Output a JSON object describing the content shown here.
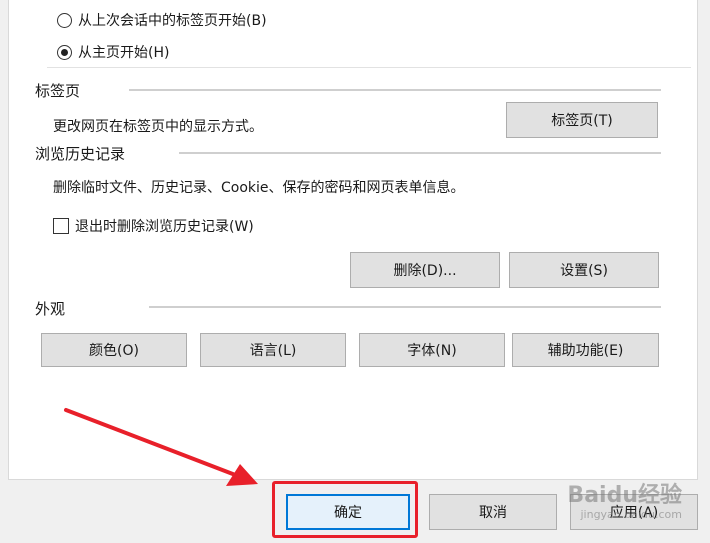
{
  "startup": {
    "option_restore": "从上次会话中的标签页开始(B)",
    "option_home": "从主页开始(H)",
    "selected": "home"
  },
  "tabs_section": {
    "title": "标签页",
    "description": "更改网页在标签页中的显示方式。",
    "button_label": "标签页(T)"
  },
  "history_section": {
    "title": "浏览历史记录",
    "description": "删除临时文件、历史记录、Cookie、保存的密码和网页表单信息。",
    "checkbox_label": "退出时删除浏览历史记录(W)",
    "checkbox_checked": false,
    "delete_label": "删除(D)...",
    "settings_label": "设置(S)"
  },
  "appearance_section": {
    "title": "外观",
    "colors_label": "颜色(O)",
    "languages_label": "语言(L)",
    "fonts_label": "字体(N)",
    "accessibility_label": "辅助功能(E)"
  },
  "footer": {
    "ok_label": "确定",
    "cancel_label": "取消",
    "apply_label": "应用(A)"
  },
  "watermark": {
    "brand": "Baidu经验",
    "url": "jingyan.baidu.com"
  },
  "colors": {
    "highlight": "#e8202a",
    "arrow": "#e8202a"
  }
}
